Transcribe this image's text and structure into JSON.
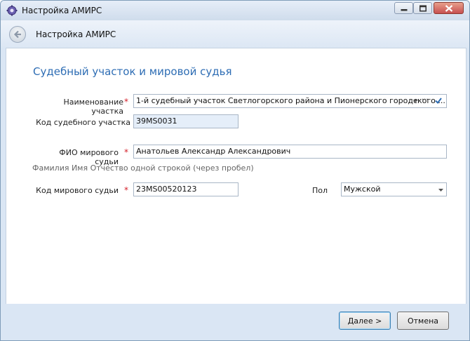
{
  "window": {
    "title": "Настройка АМИРС"
  },
  "nav": {
    "title": "Настройка АМИРС"
  },
  "form": {
    "section_title": "Судебный участок и мировой судья",
    "district_name": {
      "label": "Наименование участка",
      "required": "*",
      "value": "1-й судебный участок Светлогорского района и Пионерского городского ...",
      "more_label": "···"
    },
    "district_code": {
      "label": "Код судебного участка",
      "value": "39MS0031"
    },
    "judge_fio": {
      "label": "ФИО мирового судьи",
      "required": "*",
      "value": "Анатольев Александр Александрович",
      "hint": "Фамилия Имя Отчество одной строкой (через пробел)"
    },
    "judge_code": {
      "label": "Код мирового судьи",
      "required": "*",
      "value": "23MS00520123"
    },
    "gender": {
      "label": "Пол",
      "value": "Мужской"
    }
  },
  "footer": {
    "next_label": "Далее >",
    "cancel_label": "Отмена"
  },
  "colors": {
    "section_title": "#2e6db4",
    "required_star": "#d4202a",
    "readonly_field_bg": "#e5eef9",
    "frame_bg": "#dae6f4"
  }
}
